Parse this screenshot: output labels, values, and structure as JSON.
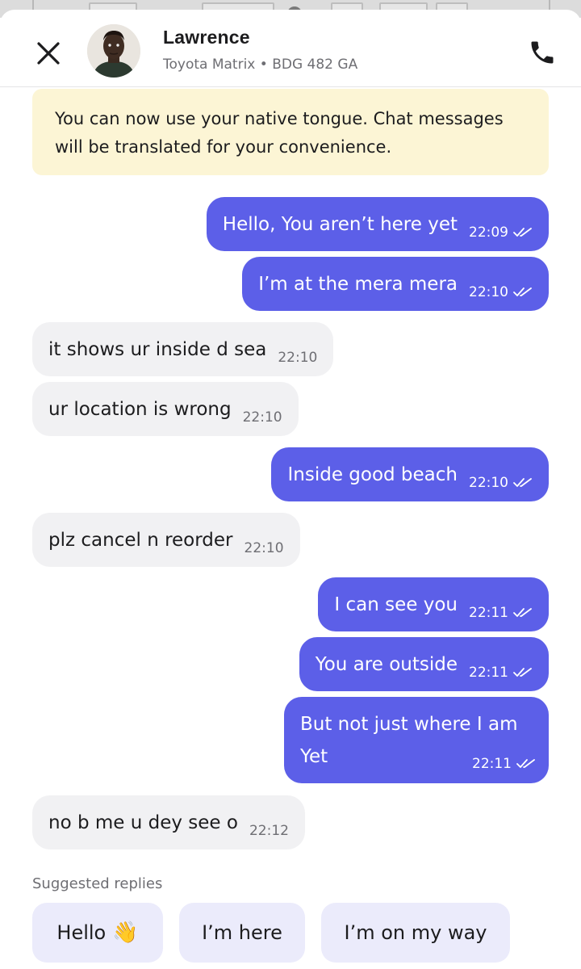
{
  "header": {
    "driver_name": "Lawrence",
    "vehicle": "Toyota Matrix",
    "separator": "•",
    "plate": "BDG 482 GA",
    "icons": {
      "close": "close-icon",
      "call": "phone-icon"
    }
  },
  "notice": {
    "text": "You can now use your native tongue. Chat messages will be translated for your convenience."
  },
  "messages": [
    {
      "direction": "out",
      "text": "Hello, You aren’t here yet",
      "time": "22:09",
      "read": true
    },
    {
      "direction": "out",
      "text": "I’m at the mera mera",
      "time": "22:10",
      "read": true
    },
    {
      "direction": "in",
      "text": "it shows ur inside d sea",
      "time": "22:10"
    },
    {
      "direction": "in",
      "text": "ur location is wrong",
      "time": "22:10"
    },
    {
      "direction": "out",
      "text": "Inside good beach",
      "time": "22:10",
      "read": true
    },
    {
      "direction": "in",
      "text": "plz cancel n reorder",
      "time": "22:10"
    },
    {
      "direction": "out",
      "text": "I can see you",
      "time": "22:11",
      "read": true
    },
    {
      "direction": "out",
      "text": "You are outside",
      "time": "22:11",
      "read": true
    },
    {
      "direction": "out",
      "text": "But not just where I am Yet",
      "time": "22:11",
      "read": true
    },
    {
      "direction": "in",
      "text": "no b me u dey see o",
      "time": "22:12"
    }
  ],
  "suggested": {
    "title": "Suggested replies",
    "chips": [
      {
        "label": "Hello",
        "emoji": "👋"
      },
      {
        "label": "I’m here"
      },
      {
        "label": "I’m on my way"
      }
    ]
  },
  "colors": {
    "outgoing_bubble": "#5c5fe8",
    "incoming_bubble": "#f1f1f3",
    "notice_bg": "#fcf5d5",
    "chip_bg": "#ebebfb"
  }
}
